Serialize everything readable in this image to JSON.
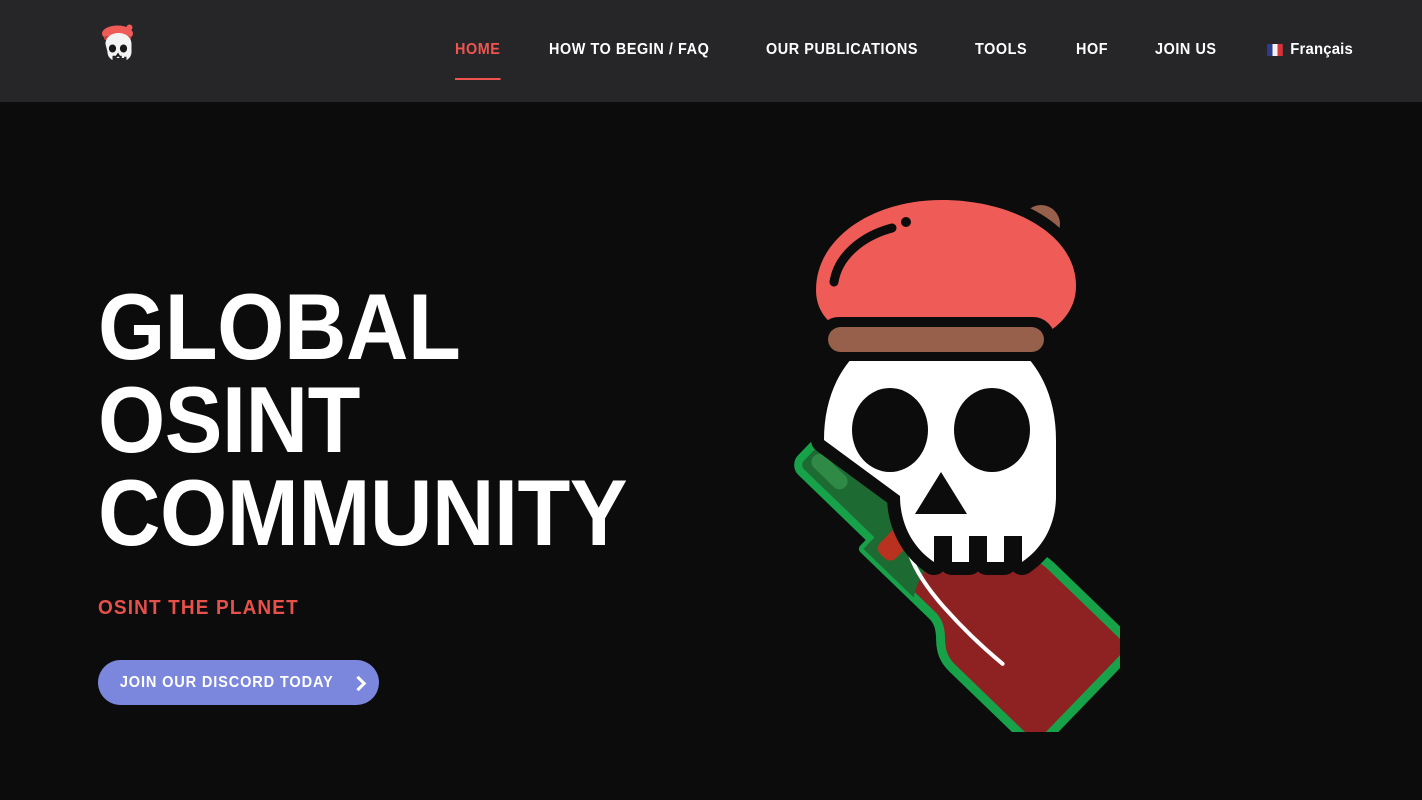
{
  "theme": {
    "header_bg": "#262628",
    "hero_bg": "#0c0c0c",
    "accent_red": "#f0544f",
    "tagline_red": "#e8504b",
    "cta_blurple": "#7b86dd",
    "text_white": "#ffffff",
    "beret_red": "#ef5b57",
    "beret_brown": "#96604a",
    "baguette_orange": "#f08030",
    "baguette_score": "#b05a28",
    "bottle_green": "#17a24a",
    "bottle_neck_green": "#1d6b33",
    "wine_red": "#8e2121"
  },
  "header": {
    "logo": {
      "icon": "skull-beret-logo",
      "alt": "Skull wearing a red beret"
    },
    "nav": [
      {
        "id": "home",
        "label": "HOME",
        "active": true
      },
      {
        "id": "how-to-begin-faq",
        "label": "HOW TO BEGIN / FAQ",
        "active": false
      },
      {
        "id": "our-publications",
        "label": "OUR PUBLICATIONS",
        "active": false
      },
      {
        "id": "tools",
        "label": "TOOLS",
        "active": false
      },
      {
        "id": "hof",
        "label": "HoF",
        "active": false
      },
      {
        "id": "join-us",
        "label": "JOIN US",
        "active": false
      }
    ],
    "language_switcher": {
      "label": "Français",
      "flag_icon": "flag-france-icon"
    }
  },
  "hero": {
    "title_lines": [
      "GLOBAL",
      "OSINT",
      "COMMUNITY"
    ],
    "tagline": "OSINT THE PLANET",
    "cta": {
      "label": "JOIN OUR DISCORD TODAY",
      "icon": "chevron-right-icon"
    },
    "artwork": {
      "name": "skull-beret-baguette-wine-illustration",
      "alt": "Skull in red beret over crossed baguette and wine bottle"
    }
  }
}
